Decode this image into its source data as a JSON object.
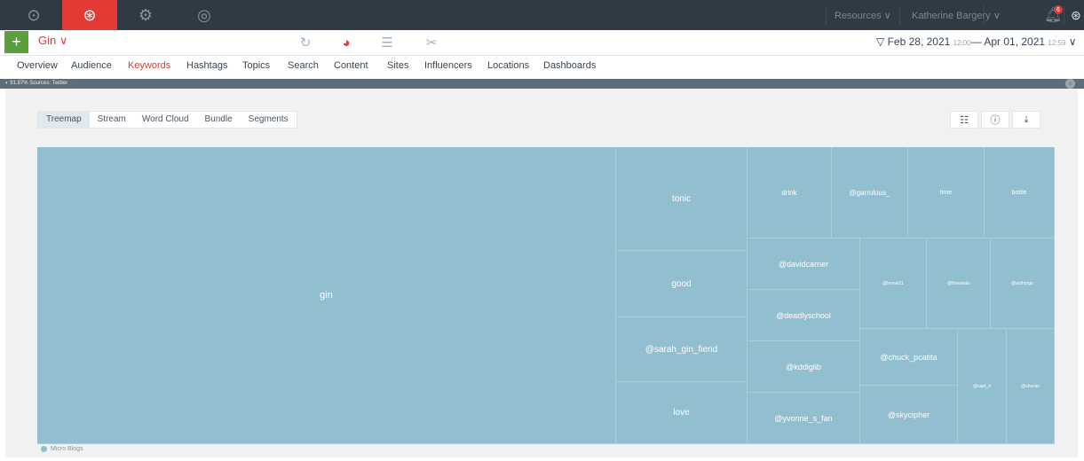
{
  "topbar": {
    "resources": "Resources ∨",
    "user": "Katherine Bargery ∨",
    "notifications": "6"
  },
  "project": {
    "name": "Gin ∨"
  },
  "date_range": {
    "start": "Feb 28, 2021",
    "start_time": "12:00",
    "sep": "—",
    "end": "Apr 01, 2021",
    "end_time": "12:59",
    "chevron": "∨"
  },
  "nav": [
    "Overview",
    "Audience",
    "Keywords",
    "Hashtags",
    "Topics",
    "Search",
    "Content",
    "Sites",
    "Influencers",
    "Locations",
    "Dashboards"
  ],
  "infobar": {
    "text": "◐ 91.87% Sources: Twitter"
  },
  "tabs": [
    "Treemap",
    "Stream",
    "Word Cloud",
    "Bundle",
    "Segments"
  ],
  "treemap": {
    "color": "#92bfcf",
    "cells": [
      {
        "label": "gin"
      },
      {
        "label": "tonic"
      },
      {
        "label": "good"
      },
      {
        "label": "@sarah_gin_fiend"
      },
      {
        "label": "love"
      },
      {
        "label": "drink"
      },
      {
        "label": "@garrulous_"
      },
      {
        "label": "time"
      },
      {
        "label": "bottle"
      },
      {
        "label": "@davidcarner"
      },
      {
        "label": "@deadlyschool"
      },
      {
        "label": "@kddiglib"
      },
      {
        "label": "@yvonne_s_fan"
      },
      {
        "label": "@leonel11"
      },
      {
        "label": "@thewesla"
      },
      {
        "label": "@authorgo"
      },
      {
        "label": "@chuck_pcatita"
      },
      {
        "label": "@skycipher"
      },
      {
        "label": "@capt_n"
      },
      {
        "label": "@chucks"
      }
    ]
  },
  "legend": {
    "label": "Micro Blogs"
  }
}
